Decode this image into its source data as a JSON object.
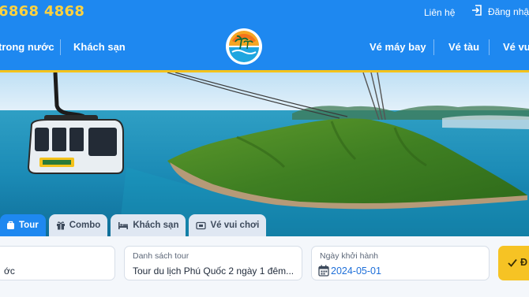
{
  "topbar": {
    "hotline": "6868 4868",
    "contact_label": "Liên hệ",
    "login_label": "Đăng nhập"
  },
  "nav": {
    "items_left": [
      "trong nước",
      "Khách sạn"
    ],
    "items_right": [
      "Vé máy bay",
      "Vé tàu",
      "Vé vui"
    ]
  },
  "tabs": [
    {
      "label": "Tour",
      "icon": "bag-icon",
      "active": true
    },
    {
      "label": "Combo",
      "icon": "gift-icon",
      "active": false
    },
    {
      "label": "Khách sạn",
      "icon": "bed-icon",
      "active": false
    },
    {
      "label": "Vé vui chơi",
      "icon": "ticket-icon",
      "active": false
    }
  ],
  "search": {
    "departure_value": "ớc",
    "tour_list_label": "Danh sách tour",
    "tour_list_value": "Tour du lịch Phú Quốc 2 ngày 1 đêm...",
    "date_label": "Ngày khởi hành",
    "date_value": "2024-05-01",
    "submit_label": "Đ"
  },
  "colors": {
    "brand_blue": "#1e88f0",
    "accent_yellow": "#f4c21b",
    "date_blue": "#1e6fd9"
  }
}
